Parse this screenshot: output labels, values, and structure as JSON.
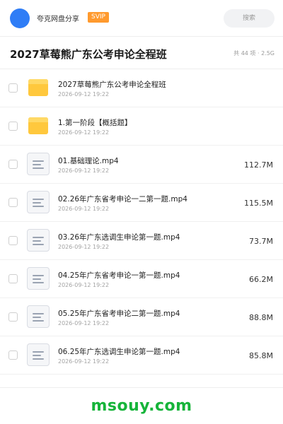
{
  "header": {
    "username": "夸克网盘分享",
    "badge": "SVIP",
    "search_placeholder": "搜索"
  },
  "title_bar": {
    "title": "2027草莓熊广东公考申论全程班",
    "meta": "共 44 项 · 2.5G"
  },
  "items": [
    {
      "type": "folder",
      "name": "2027草莓熊广东公考申论全程班",
      "date": "2026-09-12 19:22",
      "size": ""
    },
    {
      "type": "folder",
      "name": "1.第一阶段【概括题】",
      "date": "2026-09-12 19:22",
      "size": ""
    },
    {
      "type": "file",
      "name": "01.基础理论.mp4",
      "date": "2026-09-12 19:22",
      "size": "112.7M"
    },
    {
      "type": "file",
      "name": "02.26年广东省考申论一二第一题.mp4",
      "date": "2026-09-12 19:22",
      "size": "115.5M"
    },
    {
      "type": "file",
      "name": "03.26年广东选调生申论第一题.mp4",
      "date": "2026-09-12 19:22",
      "size": "73.7M"
    },
    {
      "type": "file",
      "name": "04.25年广东省考申论一第一题.mp4",
      "date": "2026-09-12 19:22",
      "size": "66.2M"
    },
    {
      "type": "file",
      "name": "05.25年广东省考申论二第一题.mp4",
      "date": "2026-09-12 19:22",
      "size": "88.8M"
    },
    {
      "type": "file",
      "name": "06.25年广东选调生申论第一题.mp4",
      "date": "2026-09-12 19:22",
      "size": "85.8M"
    }
  ],
  "watermark": "msouy.com",
  "colors": {
    "avatar": "#2f7df6",
    "badge": "#ff9a2e",
    "folder": "#ffc83d",
    "watermark": "#16b43a"
  }
}
